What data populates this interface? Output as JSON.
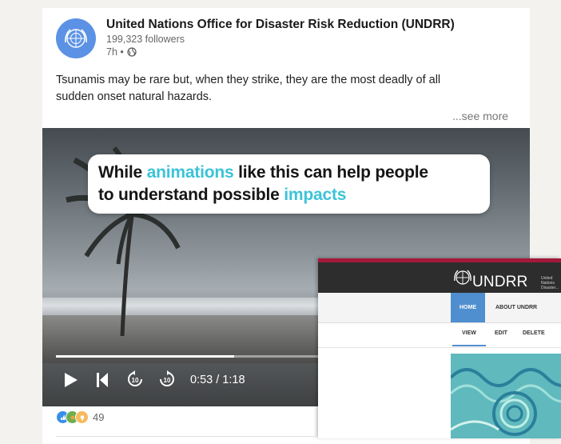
{
  "post": {
    "org_name": "United Nations Office for Disaster Risk Reduction (UNDRR)",
    "followers": "199,323 followers",
    "timestamp": "7h •",
    "visibility_icon": "globe-icon",
    "text_line1": "Tsunamis may be rare but, when they strike, they are the most deadly of all",
    "text_line2": "sudden onset natural hazards.",
    "see_more": "...see more"
  },
  "video": {
    "caption": {
      "line1_a": "While ",
      "line1_hl": "animations",
      "line1_b": " like this can help people",
      "line2_a": "to understand possible ",
      "line2_hl": "impacts"
    },
    "highlight_color": "#3cc3d8",
    "time": "0:53 / 1:18",
    "progress": 0.68,
    "controls": [
      "play-icon",
      "skip-back-icon",
      "rewind-10-icon",
      "forward-10-icon"
    ]
  },
  "overlay_site": {
    "brand": "UNDRR",
    "brand_sub": "United Nations Disaster...",
    "nav": {
      "home": "HOME",
      "about": "ABOUT UNDRR"
    },
    "tabs": [
      "VIEW",
      "EDIT",
      "DELETE"
    ],
    "accent_color": "#4f8fcf"
  },
  "reactions": {
    "icons": [
      "like-icon",
      "celebrate-icon",
      "insightful-icon"
    ],
    "count": "49"
  }
}
